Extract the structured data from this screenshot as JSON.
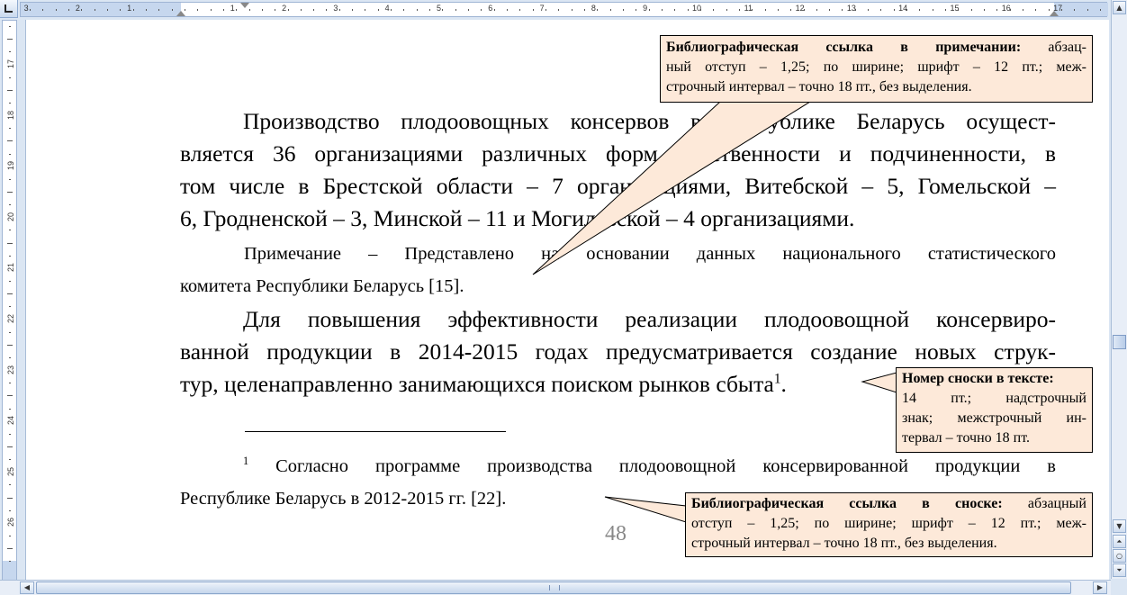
{
  "ruler": {
    "h_numbers": [
      "3",
      "2",
      "1",
      "1",
      "2",
      "3",
      "4",
      "5",
      "6",
      "7",
      "8",
      "9",
      "10",
      "11",
      "12",
      "13",
      "14",
      "15",
      "16",
      "17"
    ],
    "v_numbers": [
      "17",
      "18",
      "19",
      "20",
      "21",
      "22",
      "23",
      "24",
      "25",
      "26"
    ]
  },
  "document": {
    "para1": [
      "Производство плодоовощных консервов в Республике Беларусь осущест-",
      "вляется 36 организациями различных форм собственности и подчиненности, в",
      "том числе в Брестской области – 7 организациями, Витебской – 5, Гомельской –",
      "6, Гродненской – 3, Минской – 11 и Могилевской – 4 организациями."
    ],
    "note": [
      "Примечание – Представлено на основании данных национального статистического",
      "комитета Республики Беларусь [15]."
    ],
    "para2": [
      "Для повышения эффективности реализации плодоовощной консервиро-",
      "ванной продукции в 2014-2015 годах предусматривается создание новых струк-",
      "тур, целенаправленно занимающихся поиском рынков сбыта"
    ],
    "footnote_mark": "1",
    "para2_end": ".",
    "footnote": {
      "mark": "1",
      "line1": "Согласно программе производства плодоовощной консервированной продукции в",
      "line2": "Республике Беларусь в 2012-2015 гг. [22]."
    },
    "page_number": "48"
  },
  "callouts": {
    "note_ref": {
      "bold": "Библиографическая ссылка в примечании:",
      "line1_rest": " абзац-",
      "line2": "ный отступ – 1,25; по ширине; шрифт – 12 пт.; меж-",
      "line3": "строчный интервал – точно 18 пт., без выделения."
    },
    "footnote_mark": {
      "bold": "Номер сноски в тексте:",
      "line2": "14 пт.; надстрочный",
      "line3": "знак; межстрочный ин-",
      "line4": "тервал – точно 18 пт."
    },
    "footnote_ref": {
      "bold": "Библиографическая ссылка в сноске:",
      "line1_rest": " абзацный",
      "line2": "отступ – 1,25; по ширине; шрифт – 12 пт.; меж-",
      "line3": "строчный интервал – точно 18 пт., без выделения."
    },
    "fill_color": "#fde9d9"
  }
}
